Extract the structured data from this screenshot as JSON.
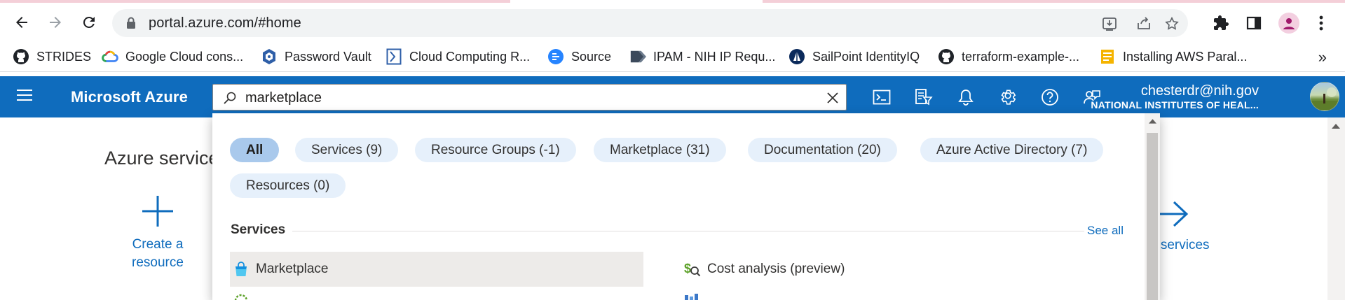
{
  "browser": {
    "url": "portal.azure.com/#home",
    "nav": {
      "back": "back-icon",
      "forward": "forward-icon",
      "reload": "reload-icon"
    },
    "omnibox_icons": [
      "install-app-icon",
      "share-icon",
      "bookmark-star-icon"
    ],
    "toolbar_icons": [
      "extensions-icon",
      "side-panel-icon",
      "profile-icon",
      "menu-icon"
    ]
  },
  "bookmarks": {
    "items": [
      {
        "label": "STRIDES",
        "icon": "github-icon"
      },
      {
        "label": "Google Cloud cons...",
        "icon": "google-cloud-icon"
      },
      {
        "label": "Password Vault",
        "icon": "vault-icon"
      },
      {
        "label": "Cloud Computing R...",
        "icon": "bookmark-page-icon"
      },
      {
        "label": "Source",
        "icon": "source-icon"
      },
      {
        "label": "IPAM - NIH IP Requ...",
        "icon": "ipam-icon"
      },
      {
        "label": "SailPoint IdentityIQ",
        "icon": "sailpoint-icon"
      },
      {
        "label": "terraform-example-...",
        "icon": "github-icon"
      },
      {
        "label": "Installing AWS Paral...",
        "icon": "document-icon"
      }
    ],
    "more": "»"
  },
  "azure": {
    "brand": "Microsoft Azure",
    "search": {
      "value": "marketplace"
    },
    "header_icons": [
      "cloud-shell-icon",
      "directory-filter-icon",
      "notifications-icon",
      "settings-icon",
      "help-icon",
      "feedback-icon"
    ],
    "account": {
      "email": "chesterdr@nih.gov",
      "org": "NATIONAL INSTITUTES OF HEAL..."
    },
    "colors": {
      "header": "#0f6cbd",
      "link": "#0f6cbd",
      "pill": "#e6f0fb",
      "pill_active": "#a9c9ec"
    }
  },
  "portal": {
    "services_title": "Azure service",
    "create_resource": {
      "line1": "Create a",
      "line2": "resource"
    },
    "more_services": "e services"
  },
  "dropdown": {
    "filters": [
      {
        "label": "All",
        "active": true
      },
      {
        "label": "Services  (9)"
      },
      {
        "label": "Resource Groups  (-1)"
      },
      {
        "label": "Marketplace  (31)"
      },
      {
        "label": "Documentation  (20)"
      },
      {
        "label": "Azure Active Directory  (7)"
      },
      {
        "label": "Resources  (0)"
      }
    ],
    "section_title": "Services",
    "see_all": "See all",
    "results": [
      {
        "label": "Marketplace",
        "icon": "marketplace-bag-icon"
      },
      {
        "label": "Cost analysis (preview)",
        "icon": "cost-analysis-icon"
      }
    ]
  }
}
